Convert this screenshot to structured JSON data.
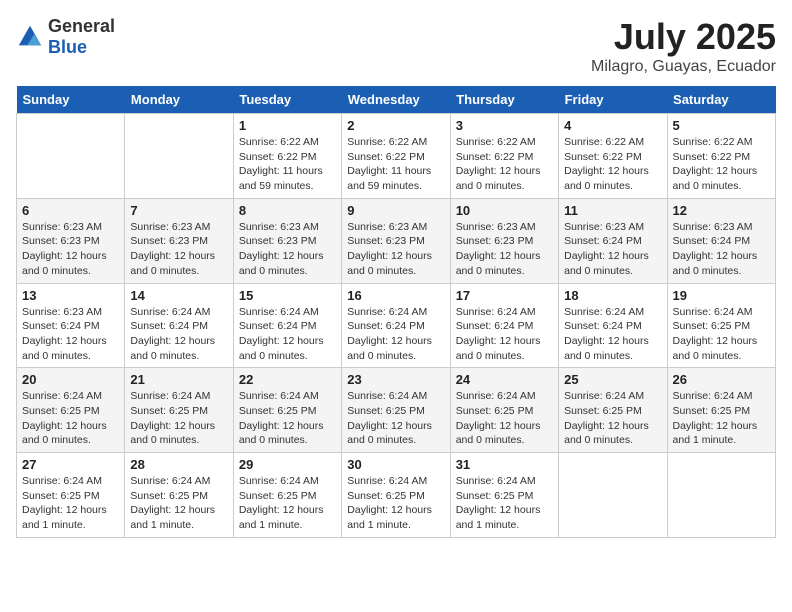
{
  "logo": {
    "general": "General",
    "blue": "Blue"
  },
  "title": "July 2025",
  "location": "Milagro, Guayas, Ecuador",
  "days_of_week": [
    "Sunday",
    "Monday",
    "Tuesday",
    "Wednesday",
    "Thursday",
    "Friday",
    "Saturday"
  ],
  "weeks": [
    [
      {
        "day": "",
        "info": ""
      },
      {
        "day": "",
        "info": ""
      },
      {
        "day": "1",
        "info": "Sunrise: 6:22 AM\nSunset: 6:22 PM\nDaylight: 11 hours\nand 59 minutes."
      },
      {
        "day": "2",
        "info": "Sunrise: 6:22 AM\nSunset: 6:22 PM\nDaylight: 11 hours\nand 59 minutes."
      },
      {
        "day": "3",
        "info": "Sunrise: 6:22 AM\nSunset: 6:22 PM\nDaylight: 12 hours\nand 0 minutes."
      },
      {
        "day": "4",
        "info": "Sunrise: 6:22 AM\nSunset: 6:22 PM\nDaylight: 12 hours\nand 0 minutes."
      },
      {
        "day": "5",
        "info": "Sunrise: 6:22 AM\nSunset: 6:22 PM\nDaylight: 12 hours\nand 0 minutes."
      }
    ],
    [
      {
        "day": "6",
        "info": "Sunrise: 6:23 AM\nSunset: 6:23 PM\nDaylight: 12 hours\nand 0 minutes."
      },
      {
        "day": "7",
        "info": "Sunrise: 6:23 AM\nSunset: 6:23 PM\nDaylight: 12 hours\nand 0 minutes."
      },
      {
        "day": "8",
        "info": "Sunrise: 6:23 AM\nSunset: 6:23 PM\nDaylight: 12 hours\nand 0 minutes."
      },
      {
        "day": "9",
        "info": "Sunrise: 6:23 AM\nSunset: 6:23 PM\nDaylight: 12 hours\nand 0 minutes."
      },
      {
        "day": "10",
        "info": "Sunrise: 6:23 AM\nSunset: 6:23 PM\nDaylight: 12 hours\nand 0 minutes."
      },
      {
        "day": "11",
        "info": "Sunrise: 6:23 AM\nSunset: 6:24 PM\nDaylight: 12 hours\nand 0 minutes."
      },
      {
        "day": "12",
        "info": "Sunrise: 6:23 AM\nSunset: 6:24 PM\nDaylight: 12 hours\nand 0 minutes."
      }
    ],
    [
      {
        "day": "13",
        "info": "Sunrise: 6:23 AM\nSunset: 6:24 PM\nDaylight: 12 hours\nand 0 minutes."
      },
      {
        "day": "14",
        "info": "Sunrise: 6:24 AM\nSunset: 6:24 PM\nDaylight: 12 hours\nand 0 minutes."
      },
      {
        "day": "15",
        "info": "Sunrise: 6:24 AM\nSunset: 6:24 PM\nDaylight: 12 hours\nand 0 minutes."
      },
      {
        "day": "16",
        "info": "Sunrise: 6:24 AM\nSunset: 6:24 PM\nDaylight: 12 hours\nand 0 minutes."
      },
      {
        "day": "17",
        "info": "Sunrise: 6:24 AM\nSunset: 6:24 PM\nDaylight: 12 hours\nand 0 minutes."
      },
      {
        "day": "18",
        "info": "Sunrise: 6:24 AM\nSunset: 6:24 PM\nDaylight: 12 hours\nand 0 minutes."
      },
      {
        "day": "19",
        "info": "Sunrise: 6:24 AM\nSunset: 6:25 PM\nDaylight: 12 hours\nand 0 minutes."
      }
    ],
    [
      {
        "day": "20",
        "info": "Sunrise: 6:24 AM\nSunset: 6:25 PM\nDaylight: 12 hours\nand 0 minutes."
      },
      {
        "day": "21",
        "info": "Sunrise: 6:24 AM\nSunset: 6:25 PM\nDaylight: 12 hours\nand 0 minutes."
      },
      {
        "day": "22",
        "info": "Sunrise: 6:24 AM\nSunset: 6:25 PM\nDaylight: 12 hours\nand 0 minutes."
      },
      {
        "day": "23",
        "info": "Sunrise: 6:24 AM\nSunset: 6:25 PM\nDaylight: 12 hours\nand 0 minutes."
      },
      {
        "day": "24",
        "info": "Sunrise: 6:24 AM\nSunset: 6:25 PM\nDaylight: 12 hours\nand 0 minutes."
      },
      {
        "day": "25",
        "info": "Sunrise: 6:24 AM\nSunset: 6:25 PM\nDaylight: 12 hours\nand 0 minutes."
      },
      {
        "day": "26",
        "info": "Sunrise: 6:24 AM\nSunset: 6:25 PM\nDaylight: 12 hours\nand 1 minute."
      }
    ],
    [
      {
        "day": "27",
        "info": "Sunrise: 6:24 AM\nSunset: 6:25 PM\nDaylight: 12 hours\nand 1 minute."
      },
      {
        "day": "28",
        "info": "Sunrise: 6:24 AM\nSunset: 6:25 PM\nDaylight: 12 hours\nand 1 minute."
      },
      {
        "day": "29",
        "info": "Sunrise: 6:24 AM\nSunset: 6:25 PM\nDaylight: 12 hours\nand 1 minute."
      },
      {
        "day": "30",
        "info": "Sunrise: 6:24 AM\nSunset: 6:25 PM\nDaylight: 12 hours\nand 1 minute."
      },
      {
        "day": "31",
        "info": "Sunrise: 6:24 AM\nSunset: 6:25 PM\nDaylight: 12 hours\nand 1 minute."
      },
      {
        "day": "",
        "info": ""
      },
      {
        "day": "",
        "info": ""
      }
    ]
  ]
}
